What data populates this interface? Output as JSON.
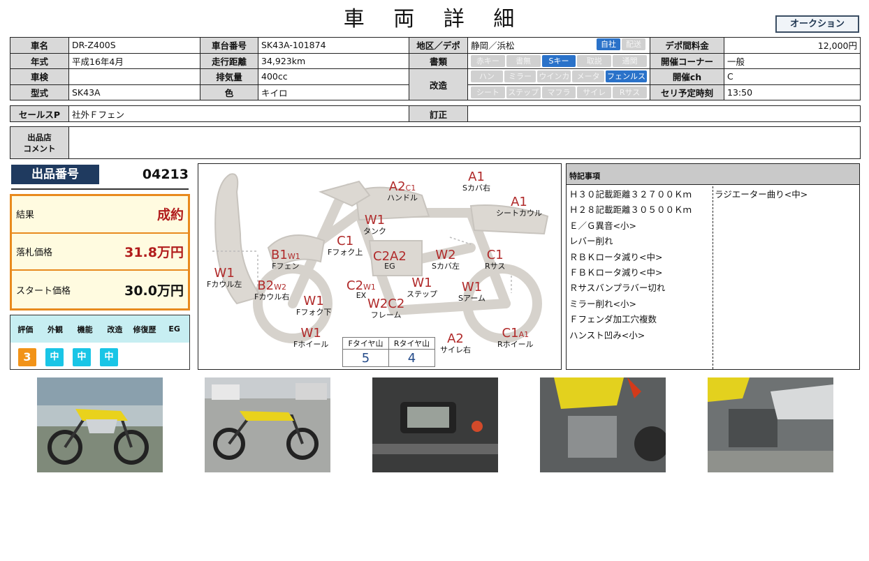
{
  "title": "車 両 詳 細",
  "auction_button": "オークション",
  "vehicle": {
    "name_label": "車名",
    "name": "DR-Z400S",
    "frame_label": "車台番号",
    "frame": "SK43A-101874",
    "region_label": "地区／デポ",
    "region": "静岡／浜松",
    "depot_tags": [
      "自社",
      "配送"
    ],
    "fee_label": "デポ間料金",
    "fee": "12,000円",
    "year_label": "年式",
    "year": "平成16年4月",
    "mileage_label": "走行距離",
    "mileage": "34,923km",
    "docs_label": "書類",
    "docs_tags": [
      "赤キー",
      "書無",
      "Sキー",
      "取説",
      "通関"
    ],
    "corner_label": "開催コーナー",
    "corner": "一般",
    "inspection_label": "車検",
    "inspection": "",
    "displacement_label": "排気量",
    "displacement": "400cc",
    "mod_label": "改造",
    "mod_tags_row1": [
      "ハン",
      "ミラー",
      "ウインカ",
      "メータ",
      "フェンルス"
    ],
    "mod_tags_row2": [
      "シート",
      "ステップ",
      "マフラ",
      "サイレ",
      "Rサス"
    ],
    "channel_label": "開催ch",
    "channel": "C",
    "model_label": "型式",
    "model": "SK43A",
    "color_label": "色",
    "color": "キイロ",
    "time_label": "セリ予定時刻",
    "time": "13:50"
  },
  "sales": {
    "label": "セールスP",
    "value": "社外Ｆフェン",
    "correction_label": "訂正",
    "correction": ""
  },
  "comment": {
    "label_line1": "出品店",
    "label_line2": "コメント",
    "value": ""
  },
  "lot": {
    "label": "出品番号",
    "number": "04213"
  },
  "prices": {
    "result_label": "結果",
    "result": "成約",
    "winning_label": "落札価格",
    "winning": "31.8万円",
    "start_label": "スタート価格",
    "start": "30.0万円"
  },
  "grades": {
    "headers": [
      "評価",
      "外観",
      "機能",
      "改造",
      "修復歴",
      "EG"
    ],
    "values": [
      "3",
      "中",
      "中",
      "中"
    ]
  },
  "damage": [
    {
      "id": "handle",
      "code": "A2",
      "sub": "C1",
      "part": "ハンドル"
    },
    {
      "id": "s-cover-r",
      "code": "A1",
      "sub": "",
      "part": "Sカバ右"
    },
    {
      "id": "seat-cowl",
      "code": "A1",
      "sub": "",
      "part": "シートカウル"
    },
    {
      "id": "tank",
      "code": "W1",
      "sub": "",
      "part": "タンク"
    },
    {
      "id": "f-fork-up",
      "code": "C1",
      "sub": "",
      "part": "Fフォク上"
    },
    {
      "id": "eg",
      "code": "C2",
      "sub": "A2",
      "part": "EG"
    },
    {
      "id": "s-cover-l",
      "code": "W2",
      "sub": "",
      "part": "Sカバ左"
    },
    {
      "id": "r-sus",
      "code": "C1",
      "sub": "",
      "part": "Rサス"
    },
    {
      "id": "f-fender",
      "code": "B1",
      "sub": "W1",
      "part": "Fフェン"
    },
    {
      "id": "f-cowl-l",
      "code": "W1",
      "sub": "",
      "part": "Fカウル左"
    },
    {
      "id": "f-cowl-r",
      "code": "B2",
      "sub": "W2",
      "part": "Fカウル右"
    },
    {
      "id": "ex",
      "code": "C2",
      "sub": "W1",
      "part": "EX"
    },
    {
      "id": "step",
      "code": "W1",
      "sub": "",
      "part": "ステップ"
    },
    {
      "id": "s-arm",
      "code": "W1",
      "sub": "",
      "part": "Sアーム"
    },
    {
      "id": "f-fork-down",
      "code": "W1",
      "sub": "",
      "part": "Fフォク下"
    },
    {
      "id": "frame",
      "code": "W2",
      "sub": "C2",
      "part": "フレーム"
    },
    {
      "id": "f-wheel",
      "code": "W1",
      "sub": "",
      "part": "Fホイール"
    },
    {
      "id": "silencer-r",
      "code": "A2",
      "sub": "",
      "part": "サイレ右"
    },
    {
      "id": "r-wheel",
      "code": "C1",
      "sub": "A1",
      "part": "Rホイール"
    }
  ],
  "tires": {
    "front_label": "Fタイヤ山",
    "rear_label": "Rタイヤ山",
    "front": "5",
    "rear": "4"
  },
  "special": {
    "header": "特記事項",
    "items": [
      "Ｈ３０記載距離３２７００Ｋｍ",
      "Ｈ２８記載距離３０５００Ｋｍ",
      "Ｅ／Ｇ異音<小>",
      "レバー削れ",
      "ＲＢＫロータ減り<中>",
      "ＦＢＫロータ減り<中>",
      "Ｒサスバンプラバー切れ",
      "ミラー削れ<小>",
      "Ｆフェンダ加工穴複数",
      "ハンスト凹み<小>"
    ],
    "items_right": [
      "ラジエーター曲り<中>"
    ]
  }
}
